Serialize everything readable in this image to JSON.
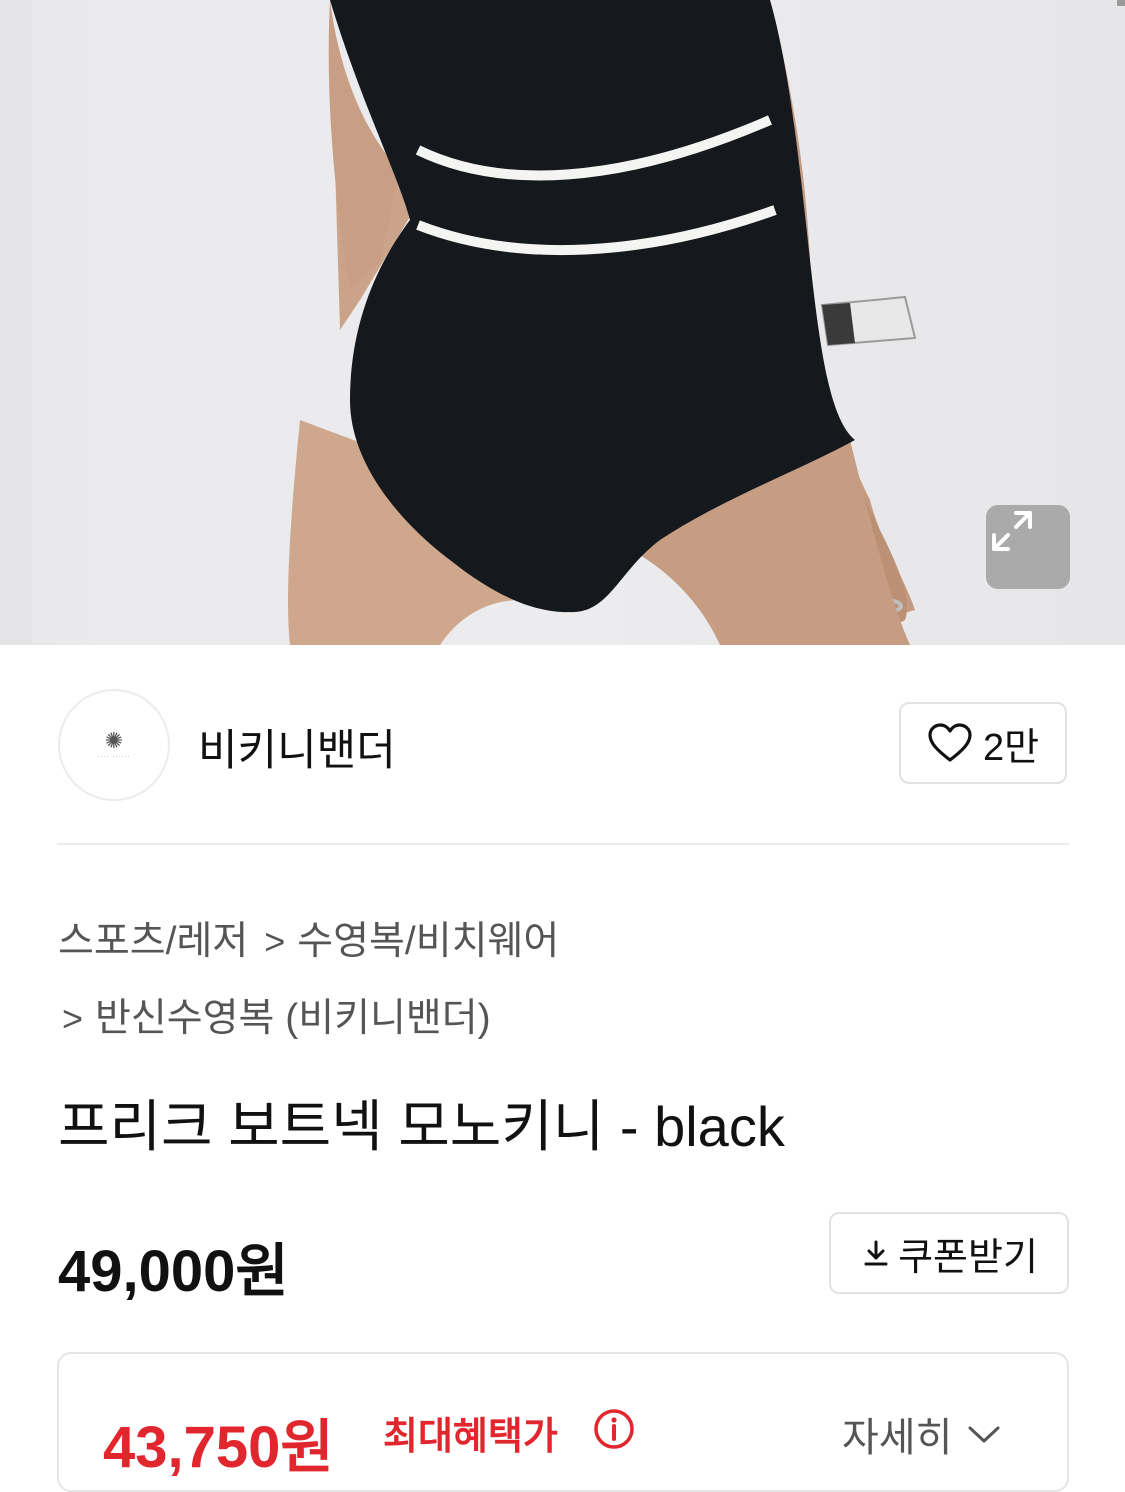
{
  "seller": {
    "name": "비키니밴더",
    "likes": "2만"
  },
  "breadcrumb": {
    "items": [
      "스포츠/레저",
      "수영복/비치웨어",
      "반신수영복 (비키니밴더)"
    ],
    "separator": ">"
  },
  "product": {
    "title": "프리크 보트넥 모노키니 - black",
    "price": "49,000원",
    "coupon_label": "쿠폰받기",
    "benefit_price": "43,750원",
    "benefit_label": "최대혜택가",
    "detail_label": "자세히"
  },
  "icons": {
    "expand": "expand-icon",
    "heart": "heart-icon",
    "download": "download-icon",
    "info": "info-icon",
    "chevron": "chevron-down-icon"
  },
  "colors": {
    "accent_red": "#e1262d",
    "text": "#111111",
    "muted": "#555555"
  }
}
